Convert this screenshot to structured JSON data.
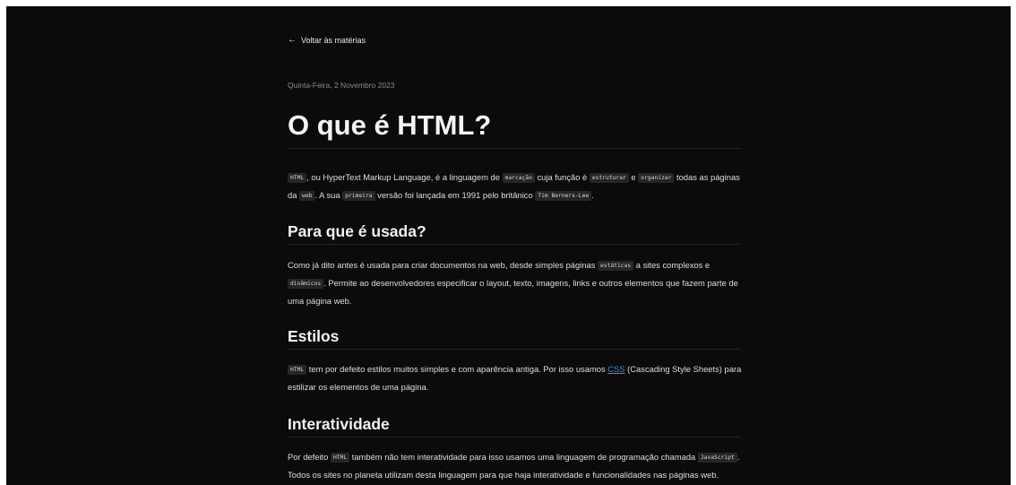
{
  "nav": {
    "back_arrow": "←",
    "back_label": "Voltar às matérias"
  },
  "article": {
    "date": "Quinta-Feira, 2 Novembro 2023",
    "title": "O que é HTML?",
    "intro": {
      "code_html": "HTML",
      "t1": ", ou HyperText Markup Language, é a linguagem de ",
      "code_marcacao": "marcação",
      "t2": " cuja função é ",
      "code_estruturar": "estruturar",
      "t3": " e ",
      "code_organizar": "organizar",
      "t4": " todas as páginas da ",
      "code_web": "web",
      "t5": ". A sua ",
      "code_primeira": "primeira",
      "t6": " versão foi lançada em 1991 pelo britânico ",
      "code_tim": "Tim Berners-Lee",
      "t7": "."
    },
    "sections": [
      {
        "heading": "Para que é usada?",
        "t1": "Como já dito antes é usada para criar documentos na web, desde simples páginas ",
        "code_estaticas": "estáticas",
        "t2": " a sites complexos e ",
        "code_dinamicos": "dinâmicos",
        "t3": ". Permite ao desenvolvedores especificar o layout, texto, imagens, links e outros elementos que fazem parte de uma página web."
      },
      {
        "heading": "Estilos",
        "code_html": "HTML",
        "t1": " tem por defeito estilos muitos simples e com aparência antiga. Por isso usamos ",
        "link_css": "CSS",
        "t2": " (Cascading Style Sheets) para estilizar os elementos de uma página."
      },
      {
        "heading": "Interatividade",
        "t1": "Por defeito ",
        "code_html": "HTML",
        "t2": " também não tem interatividade para isso usamos uma linguagem de programação chamada ",
        "code_js": "JavaScript",
        "t3": ". Todos os sites no planeta utilizam desta linguagem para que haja interatividade e funcionalidades nas páginas web."
      }
    ]
  }
}
